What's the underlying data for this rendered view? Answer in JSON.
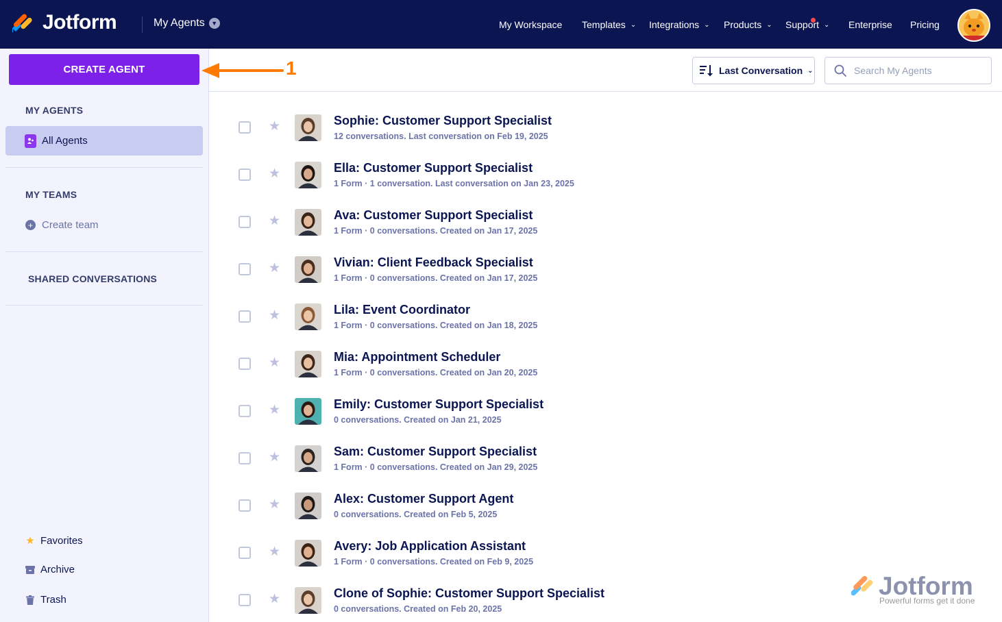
{
  "topbar": {
    "brand": "Jotform",
    "breadcrumb": "My Agents",
    "nav": [
      {
        "label": "My Workspace",
        "has_chevron": false
      },
      {
        "label": "Templates",
        "has_chevron": true
      },
      {
        "label": "Integrations",
        "has_chevron": true
      },
      {
        "label": "Products",
        "has_chevron": true
      },
      {
        "label": "Support",
        "has_chevron": true,
        "notification_dot": true
      },
      {
        "label": "Enterprise",
        "has_chevron": false
      },
      {
        "label": "Pricing",
        "has_chevron": false
      }
    ],
    "avatar_icon": "cat-avatar-icon"
  },
  "sidebar": {
    "create_button": "CREATE AGENT",
    "my_agents_heading": "MY AGENTS",
    "all_agents": "All Agents",
    "my_teams_heading": "MY TEAMS",
    "create_team": "Create team",
    "shared_conversations": "SHARED CONVERSATIONS",
    "favorites": "Favorites",
    "archive": "Archive",
    "trash": "Trash"
  },
  "annotation": {
    "number": "1",
    "color": "#ff7a00"
  },
  "toolbar": {
    "sort_label": "Last Conversation",
    "search_placeholder": "Search My Agents"
  },
  "agents": [
    {
      "name": "Sophie: Customer Support Specialist",
      "meta": "12 conversations. Last conversation on Feb 19, 2025"
    },
    {
      "name": "Ella: Customer Support Specialist",
      "meta": "1 Form · 1 conversation. Last conversation on Jan 23, 2025"
    },
    {
      "name": "Ava: Customer Support Specialist",
      "meta": "1 Form · 0 conversations. Created on Jan 17, 2025"
    },
    {
      "name": "Vivian: Client Feedback Specialist",
      "meta": "1 Form · 0 conversations. Created on Jan 17, 2025"
    },
    {
      "name": "Lila: Event Coordinator",
      "meta": "1 Form · 0 conversations. Created on Jan 18, 2025"
    },
    {
      "name": "Mia: Appointment Scheduler",
      "meta": "1 Form · 0 conversations. Created on Jan 20, 2025"
    },
    {
      "name": "Emily: Customer Support Specialist",
      "meta": "0 conversations. Created on Jan 21, 2025"
    },
    {
      "name": "Sam: Customer Support Specialist",
      "meta": "1 Form · 0 conversations. Created on Jan 29, 2025"
    },
    {
      "name": "Alex: Customer Support Agent",
      "meta": "0 conversations. Created on Feb 5, 2025"
    },
    {
      "name": "Avery: Job Application Assistant",
      "meta": "1 Form · 0 conversations. Created on Feb 9, 2025"
    },
    {
      "name": "Clone of Sophie: Customer Support Specialist",
      "meta": "0 conversations. Created on Feb 20, 2025"
    }
  ],
  "watermark": {
    "brand": "Jotform",
    "tagline": "Powerful forms get it done"
  },
  "colors": {
    "nav_bg": "#0a1551",
    "accent": "#7d20e8",
    "sidebar_bg": "#f3f3fe",
    "active_item": "#c8ccf0"
  }
}
